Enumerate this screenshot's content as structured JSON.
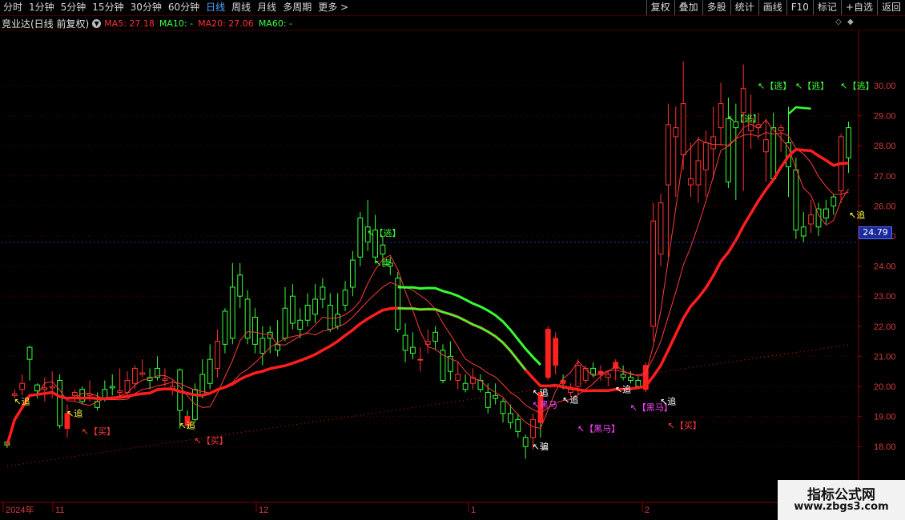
{
  "toolbar": {
    "periods": [
      "分时",
      "1分钟",
      "5分钟",
      "15分钟",
      "30分钟",
      "60分钟",
      "日线",
      "周线",
      "月线",
      "多周期",
      "更多"
    ],
    "active_period": "日线",
    "more_chevron": ">",
    "right_buttons": [
      "复权",
      "叠加",
      "多股",
      "统计",
      "画线",
      "F10",
      "标记",
      "+自选",
      "返回"
    ]
  },
  "info": {
    "stock_name": "竞业达(日线 前复权)",
    "ma5": "MA5: 27.18",
    "ma10": "MA10: -",
    "ma20": "MA20: 27.06",
    "ma60": "MA60: -"
  },
  "price_tag": "24.79",
  "watermark": {
    "title": "指标公式网",
    "url": "www.zbgs3.com"
  },
  "chart_data": {
    "type": "candlestick",
    "y_axis_ticks": [
      "30.00",
      "29.00",
      "28.00",
      "27.00",
      "26.00",
      "25.00",
      "24.00",
      "23.00",
      "22.00",
      "21.00",
      "20.00",
      "19.00",
      "18.00"
    ],
    "x_axis_labels": [
      "2024年",
      "11",
      "12",
      "1",
      "2"
    ],
    "ylim": [
      17.2,
      31.2
    ],
    "current_price": 24.79,
    "candles": [
      [
        18.15,
        18.05,
        18.2,
        17.95
      ],
      [
        19.7,
        19.75,
        19.9,
        19.6
      ],
      [
        19.9,
        20.1,
        20.4,
        19.7
      ],
      [
        21.3,
        20.9,
        21.35,
        20.2
      ],
      [
        20.05,
        19.85,
        20.1,
        19.6
      ],
      [
        19.9,
        19.95,
        20.3,
        19.5
      ],
      [
        19.95,
        20.0,
        20.5,
        19.6
      ],
      [
        20.2,
        18.7,
        20.4,
        18.6
      ],
      [
        18.6,
        19.1,
        19.4,
        18.3
      ],
      [
        19.7,
        19.8,
        19.9,
        19.5
      ],
      [
        19.9,
        19.5,
        20.0,
        19.4
      ],
      [
        19.7,
        19.75,
        20.2,
        19.5
      ],
      [
        19.5,
        19.3,
        19.8,
        19.2
      ],
      [
        19.9,
        19.6,
        20.2,
        19.5
      ],
      [
        20.0,
        19.95,
        20.4,
        19.7
      ],
      [
        19.8,
        19.85,
        20.6,
        19.6
      ],
      [
        19.8,
        20.2,
        20.5,
        19.7
      ],
      [
        20.1,
        20.6,
        20.7,
        19.9
      ],
      [
        20.4,
        20.45,
        20.9,
        20.3
      ],
      [
        20.3,
        20.2,
        20.6,
        19.9
      ],
      [
        20.6,
        20.3,
        21.0,
        20.2
      ],
      [
        20.2,
        20.25,
        20.6,
        20.0
      ],
      [
        19.9,
        20.0,
        20.2,
        19.7
      ],
      [
        20.55,
        19.2,
        20.6,
        18.6
      ],
      [
        19.0,
        18.7,
        19.2,
        18.6
      ],
      [
        19.9,
        18.9,
        20.1,
        18.8
      ],
      [
        20.4,
        19.7,
        20.9,
        19.6
      ],
      [
        20.9,
        20.1,
        21.4,
        19.9
      ],
      [
        20.6,
        21.5,
        21.9,
        20.3
      ],
      [
        22.5,
        21.4,
        22.6,
        21.1
      ],
      [
        23.3,
        21.6,
        24.1,
        21.4
      ],
      [
        23.7,
        23.0,
        24.1,
        22.6
      ],
      [
        22.9,
        21.6,
        23.2,
        21.4
      ],
      [
        22.3,
        21.4,
        22.6,
        21.1
      ],
      [
        21.6,
        21.1,
        22.0,
        20.7
      ],
      [
        21.8,
        21.6,
        22.0,
        21.1
      ],
      [
        21.4,
        21.2,
        22.2,
        21.0
      ],
      [
        22.6,
        21.6,
        23.3,
        21.5
      ],
      [
        23.0,
        22.1,
        23.4,
        21.9
      ],
      [
        22.2,
        21.9,
        22.6,
        21.6
      ],
      [
        22.7,
        22.2,
        23.1,
        22.0
      ],
      [
        22.9,
        22.4,
        23.4,
        22.1
      ],
      [
        23.3,
        22.9,
        23.6,
        22.6
      ],
      [
        22.7,
        21.9,
        23.1,
        21.8
      ],
      [
        22.4,
        22.0,
        23.1,
        21.9
      ],
      [
        23.2,
        22.7,
        23.5,
        22.5
      ],
      [
        24.2,
        23.3,
        24.5,
        23.0
      ],
      [
        25.6,
        24.3,
        25.8,
        24.0
      ],
      [
        25.3,
        24.8,
        26.2,
        24.5
      ],
      [
        25.2,
        24.3,
        25.7,
        24.1
      ],
      [
        24.7,
        24.4,
        25.0,
        24.0
      ],
      [
        24.1,
        24.0,
        24.3,
        23.7
      ],
      [
        23.6,
        21.9,
        23.8,
        21.8
      ],
      [
        21.7,
        21.2,
        22.1,
        20.8
      ],
      [
        21.3,
        21.1,
        21.8,
        20.9
      ],
      [
        20.9,
        20.9,
        21.3,
        20.5
      ],
      [
        21.4,
        21.5,
        21.9,
        21.1
      ],
      [
        21.8,
        21.5,
        22.0,
        21.2
      ],
      [
        21.2,
        20.2,
        21.4,
        20.1
      ],
      [
        21.0,
        20.5,
        21.5,
        20.2
      ],
      [
        20.2,
        20.4,
        20.8,
        19.9
      ],
      [
        20.1,
        19.9,
        20.4,
        19.8
      ],
      [
        20.1,
        20.3,
        20.6,
        19.9
      ],
      [
        20.2,
        19.9,
        20.4,
        19.8
      ],
      [
        19.8,
        19.3,
        20.1,
        19.1
      ],
      [
        19.7,
        19.6,
        20.1,
        19.4
      ],
      [
        19.5,
        19.1,
        19.6,
        18.8
      ],
      [
        19.1,
        18.8,
        19.4,
        18.6
      ],
      [
        18.9,
        18.5,
        19.1,
        18.3
      ],
      [
        18.3,
        18.0,
        18.4,
        17.6
      ],
      [
        18.3,
        18.9,
        19.1,
        17.9
      ],
      [
        19.8,
        18.8,
        19.9,
        18.3
      ],
      [
        20.3,
        21.9,
        22.0,
        20.2
      ],
      [
        20.7,
        21.6,
        21.8,
        20.4
      ],
      [
        20.2,
        20.1,
        20.4,
        19.9
      ],
      [
        19.8,
        19.9,
        20.1,
        19.7
      ],
      [
        20.0,
        20.7,
        20.9,
        19.7
      ],
      [
        20.2,
        20.6,
        20.7,
        20.1
      ],
      [
        20.6,
        20.4,
        20.8,
        20.3
      ],
      [
        20.4,
        20.5,
        20.7,
        20.2
      ],
      [
        20.3,
        20.4,
        20.5,
        20.0
      ],
      [
        20.6,
        20.8,
        20.9,
        20.2
      ],
      [
        20.4,
        20.3,
        20.7,
        20.2
      ],
      [
        20.3,
        20.2,
        20.5,
        20.1
      ],
      [
        20.2,
        20.0,
        20.3,
        19.9
      ],
      [
        19.9,
        20.7,
        20.8,
        19.8
      ],
      [
        22.0,
        25.5,
        26.1,
        21.5
      ],
      [
        24.4,
        26.1,
        26.4,
        24.0
      ],
      [
        26.7,
        28.7,
        29.4,
        24.3
      ],
      [
        28.3,
        28.6,
        29.3,
        26.3
      ],
      [
        27.7,
        29.4,
        30.8,
        27.2
      ],
      [
        26.7,
        26.9,
        28.1,
        26.3
      ],
      [
        26.7,
        27.5,
        28.3,
        26.1
      ],
      [
        27.2,
        28.1,
        28.5,
        26.3
      ],
      [
        27.9,
        28.3,
        29.3,
        26.9
      ],
      [
        28.6,
        29.4,
        30.1,
        28.0
      ],
      [
        28.9,
        26.8,
        29.6,
        26.6
      ],
      [
        28.8,
        28.6,
        29.4,
        26.2
      ],
      [
        29.1,
        29.9,
        30.7,
        26.5
      ],
      [
        28.5,
        28.9,
        29.7,
        27.9
      ],
      [
        28.6,
        28.7,
        29.1,
        28.2
      ],
      [
        27.8,
        28.2,
        28.9,
        26.8
      ],
      [
        28.6,
        26.9,
        29.1,
        26.9
      ],
      [
        28.5,
        28.6,
        28.7,
        27.8
      ],
      [
        28.1,
        27.3,
        29.3,
        26.3
      ],
      [
        27.2,
        25.2,
        27.6,
        24.9
      ],
      [
        25.3,
        25.0,
        25.8,
        24.8
      ],
      [
        25.4,
        25.7,
        26.2,
        25.1
      ],
      [
        25.9,
        25.3,
        26.1,
        25.0
      ],
      [
        25.9,
        25.6,
        26.2,
        25.4
      ],
      [
        26.3,
        26.0,
        26.4,
        25.7
      ],
      [
        26.5,
        28.3,
        28.4,
        26.1
      ],
      [
        28.6,
        27.6,
        28.8,
        27.1
      ]
    ],
    "signal_labels": [
      {
        "text": "追",
        "color": "yellow"
      },
      {
        "text": "追",
        "color": "yellow"
      },
      {
        "text": "【买】",
        "color": "red"
      },
      {
        "text": "追",
        "color": "yellow"
      },
      {
        "text": "【买】",
        "color": "red"
      },
      {
        "text": "【逃】",
        "color": "green"
      },
      {
        "text": "卖",
        "color": "green"
      },
      {
        "text": "追",
        "color": "white"
      },
      {
        "text": "黑马",
        "color": "magenta"
      },
      {
        "text": "追",
        "color": "white"
      },
      {
        "text": "【黑马】",
        "color": "magenta"
      },
      {
        "text": "追",
        "color": "white"
      },
      {
        "text": "【黑马】",
        "color": "magenta"
      },
      {
        "text": "骗",
        "color": "white"
      },
      {
        "text": "追",
        "color": "white"
      },
      {
        "text": "【买】",
        "color": "red"
      },
      {
        "text": "【逃】",
        "color": "green"
      },
      {
        "text": "【逃】",
        "color": "green"
      },
      {
        "text": "【逃】",
        "color": "green"
      },
      {
        "text": "【逃】",
        "color": "green"
      },
      {
        "text": "追",
        "color": "yellow"
      }
    ]
  }
}
